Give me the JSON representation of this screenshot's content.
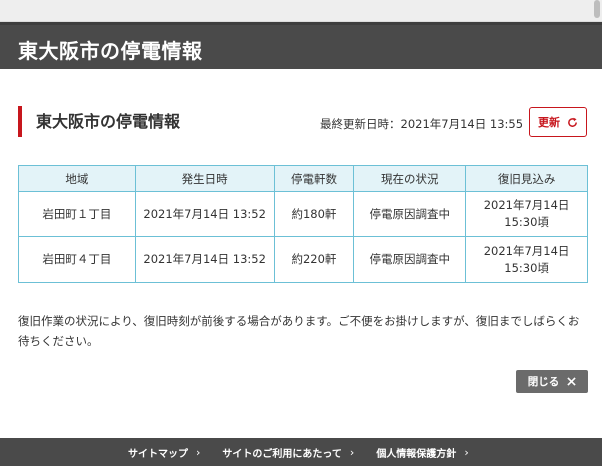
{
  "header": {
    "title": "東大阪市の停電情報"
  },
  "section": {
    "title": "東大阪市の停電情報",
    "updated_label": "最終更新日時：",
    "updated_value": "2021年7月14日 13:55",
    "refresh_label": "更新",
    "refresh_icon": "refresh-icon"
  },
  "table": {
    "headers": [
      "地域",
      "発生日時",
      "停電軒数",
      "現在の状況",
      "復旧見込み"
    ],
    "rows": [
      {
        "area": "岩田町１丁目",
        "occurred": "2021年7月14日 13:52",
        "count": "約180軒",
        "status": "停電原因調査中",
        "eta_date": "2021年7月14日",
        "eta_time": "15:30頃"
      },
      {
        "area": "岩田町４丁目",
        "occurred": "2021年7月14日 13:52",
        "count": "約220軒",
        "status": "停電原因調査中",
        "eta_date": "2021年7月14日",
        "eta_time": "15:30頃"
      }
    ]
  },
  "note": "復旧作業の状況により、復旧時刻が前後する場合があります。ご不便をお掛けしますが、復旧までしばらくお待ちください。",
  "close": {
    "label": "閉じる",
    "icon": "close-icon"
  },
  "footer": {
    "links": [
      {
        "label": "サイトマップ",
        "chevron": "›"
      },
      {
        "label": "サイトのご利用にあたって",
        "chevron": "›"
      },
      {
        "label": "個人情報保護方針",
        "chevron": "›"
      }
    ]
  },
  "colors": {
    "accent": "#c7161d",
    "header_bg": "#4a4a4a",
    "table_border": "#6cc0d6",
    "table_header_bg": "#e3f3f8",
    "close_bg": "#6b6b6b"
  }
}
